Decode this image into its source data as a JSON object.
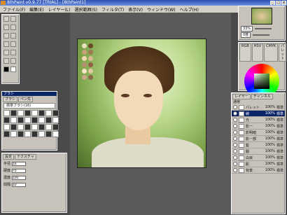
{
  "window": {
    "title": "8thPaint v0.9.77 [TRIAL] - [8thPaint1]",
    "controls": [
      "_",
      "□",
      "×"
    ]
  },
  "menu": [
    "ファイル(F)",
    "編集(E)",
    "レイヤー(L)",
    "選択範囲(S)",
    "フィルタ(T)",
    "表示(V)",
    "ウィンドウ(W)",
    "ヘルプ(H)"
  ],
  "navigator": {
    "zoom": "33%",
    "angle": "0度"
  },
  "color_panel": {
    "tabs": [
      "RGB",
      "HSV",
      "CMYK",
      "パレット"
    ]
  },
  "brush_panel": {
    "title": "ブラシ",
    "tabs": [
      "ブラシ",
      "ペン先"
    ],
    "preset": "標準ブラシ(16)"
  },
  "brush_settings": {
    "tabs": [
      "設定",
      "テクスチャ"
    ],
    "fields": [
      {
        "label": "半径",
        "value": "16"
      },
      {
        "label": "硬度",
        "value": "75"
      },
      {
        "label": "濃度",
        "value": "100"
      },
      {
        "label": "間隔",
        "value": "10"
      }
    ]
  },
  "layer_panel": {
    "tabs": [
      "レイヤー",
      "チャンネル"
    ],
    "blend_mode": "通常",
    "layers": [
      {
        "name": "パレット",
        "pct": "100%",
        "mode": "標準"
      },
      {
        "name": "線",
        "pct": "100%",
        "mode": "標準",
        "selected": true
      },
      {
        "name": "光",
        "pct": "100%",
        "mode": "標準"
      },
      {
        "name": "影ー",
        "pct": "100%",
        "mode": "標準"
      },
      {
        "name": "影明暗",
        "pct": "100%",
        "mode": "標準"
      },
      {
        "name": "影ー部",
        "pct": "100%",
        "mode": "標準"
      },
      {
        "name": "髪",
        "pct": "100%",
        "mode": "標準"
      },
      {
        "name": "服",
        "pct": "100%",
        "mode": "標準"
      },
      {
        "name": "白目",
        "pct": "100%",
        "mode": "標準"
      },
      {
        "name": "肌",
        "pct": "100%",
        "mode": "標準"
      },
      {
        "name": "背景",
        "pct": "100%",
        "mode": "標準"
      }
    ]
  },
  "palette_swatches": [
    "#e8e0c0",
    "#6b4a2a",
    "#c9a27a",
    "#a07850",
    "#f0d8b0",
    "#d8b890",
    "#b89070",
    "#906040",
    "#f4e4c8",
    "#e0c8a0",
    "#caa888",
    "#8a6848"
  ]
}
